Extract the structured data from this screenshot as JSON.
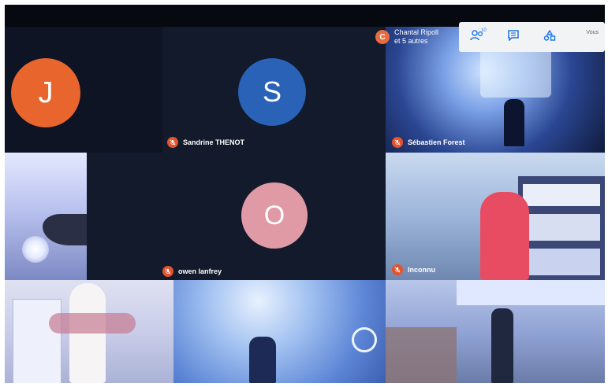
{
  "colors": {
    "background": "#0d1422",
    "mic_muted": "#e5532d",
    "toolbar_bg": "#f2f3f5",
    "toolbar_icon": "#1a73e8"
  },
  "participants": {
    "j": {
      "initial": "J",
      "color": "#e8652e"
    },
    "s": {
      "initial": "S",
      "name": "Sandrine THENOT",
      "color": "#2a62b8"
    },
    "o": {
      "initial": "O",
      "name": "owen lanfrey",
      "color": "#e09aa6"
    },
    "seb": {
      "name": "Sébastien Forest"
    },
    "inconnu": {
      "name": "Inconnu"
    }
  },
  "top_chip": {
    "initial": "C",
    "line1": "Chantal Ripoll",
    "line2": "et 5 autres"
  },
  "toolbar": {
    "people_count": "10",
    "you_label": "Vous",
    "icons": [
      "people-icon",
      "chat-icon",
      "activities-icon"
    ]
  }
}
